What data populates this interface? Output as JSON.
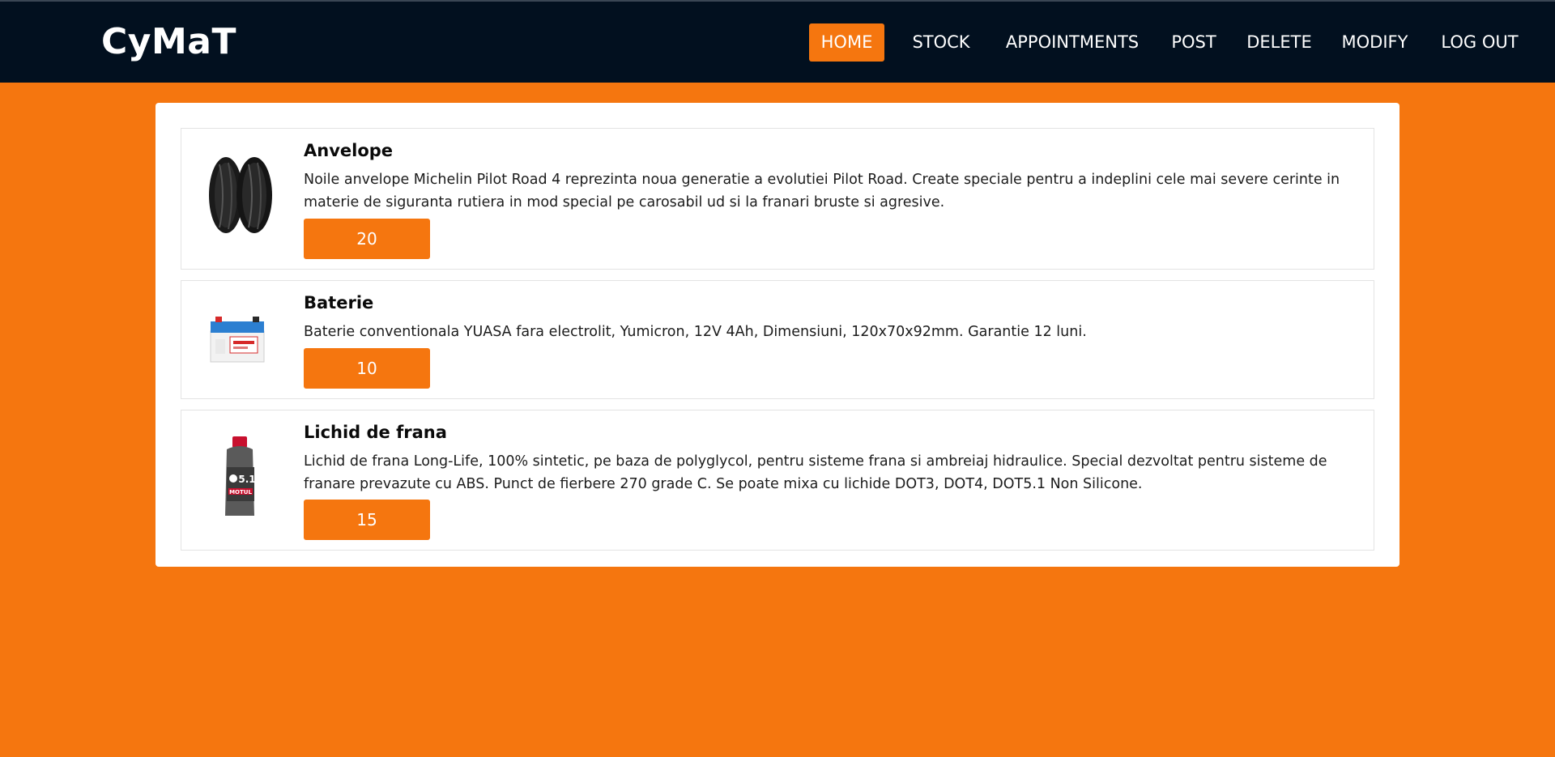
{
  "brand": "CyMaT",
  "colors": {
    "accent": "#f5760f",
    "navbar": "#02101f",
    "panel": "#ffffff"
  },
  "nav": {
    "items": [
      {
        "label": "HOME",
        "active": true
      },
      {
        "label": "STOCK",
        "active": false
      },
      {
        "label": "APPOINTMENTS",
        "active": false
      },
      {
        "label": "POST",
        "active": false
      },
      {
        "label": "DELETE",
        "active": false
      },
      {
        "label": "MODIFY",
        "active": false
      },
      {
        "label": "LOG OUT",
        "active": false
      }
    ]
  },
  "products": [
    {
      "name": "Anvelope",
      "description": "Noile anvelope Michelin Pilot Road 4 reprezinta noua generatie a evolutiei Pilot Road. Create speciale pentru a indeplini cele mai severe cerinte in materie de siguranta rutiera in mod special pe carosabil ud si la franari bruste si agresive.",
      "quantity": "20",
      "image": "tires-image"
    },
    {
      "name": "Baterie",
      "description": "Baterie conventionala YUASA fara electrolit, Yumicron, 12V 4Ah, Dimensiuni, 120x70x92mm. Garantie 12 luni.",
      "quantity": "10",
      "image": "battery-image"
    },
    {
      "name": "Lichid de frana",
      "description": "Lichid de frana Long-Life, 100% sintetic, pe baza de polyglycol, pentru sisteme frana si ambreiaj hidraulice. Special dezvoltat pentru sisteme de franare prevazute cu ABS. Punct de fierbere 270 grade C. Se poate mixa cu lichide DOT3, DOT4, DOT5.1 Non Silicone.",
      "quantity": "15",
      "image": "brake-fluid-image",
      "image_text": {
        "brand": "MOTUL",
        "grade": "5.1"
      }
    }
  ]
}
